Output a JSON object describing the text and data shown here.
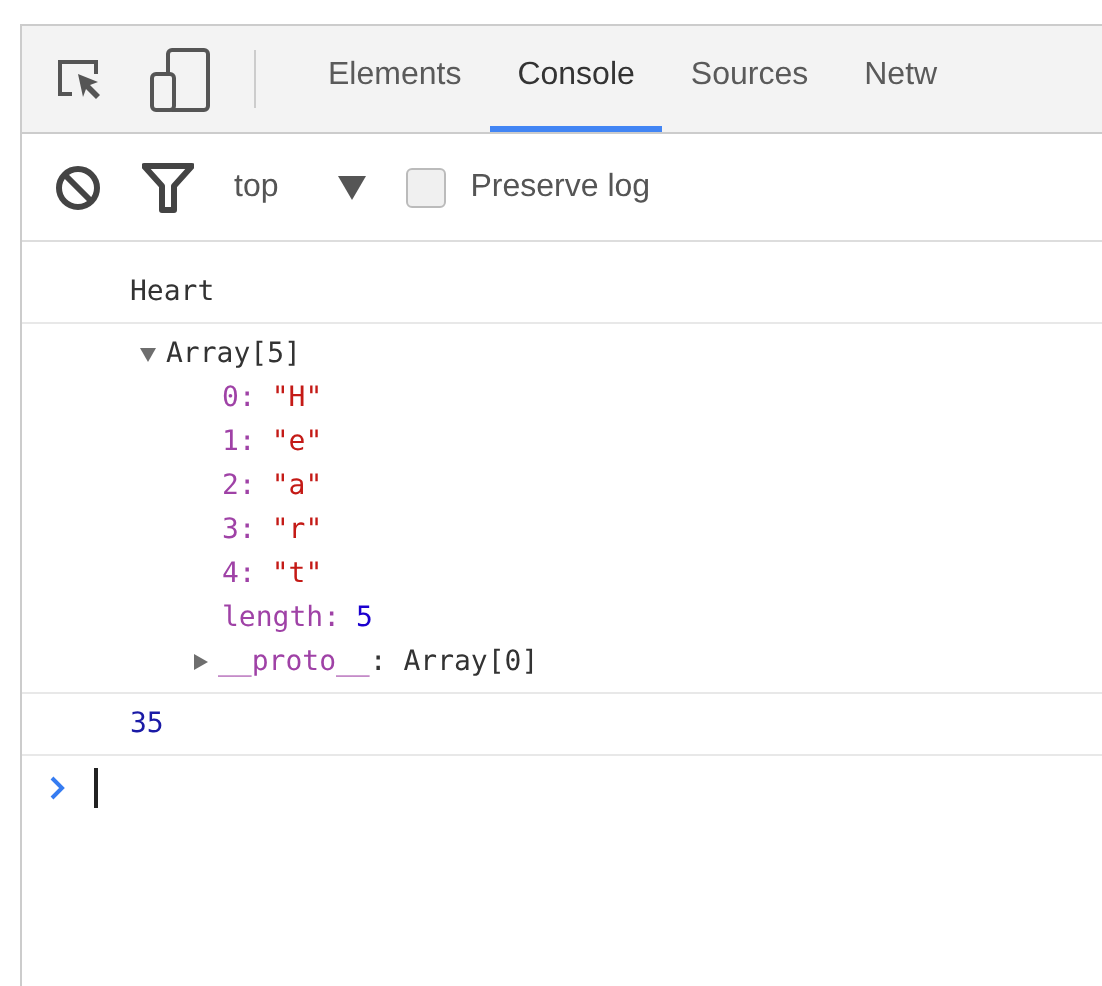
{
  "tabs": [
    {
      "label": "Elements",
      "selected": false
    },
    {
      "label": "Console",
      "selected": true
    },
    {
      "label": "Sources",
      "selected": false
    },
    {
      "label": "Netw",
      "selected": false
    }
  ],
  "filter_bar": {
    "context": "top",
    "preserve_log": {
      "label": "Preserve log",
      "checked": false
    }
  },
  "console": [
    {
      "kind": "log",
      "text": "Heart"
    },
    {
      "kind": "object",
      "label": "Array[5]",
      "expanded": true,
      "properties": [
        {
          "key": "0:",
          "value": "\"H\"",
          "kind": "string"
        },
        {
          "key": "1:",
          "value": "\"e\"",
          "kind": "string"
        },
        {
          "key": "2:",
          "value": "\"a\"",
          "kind": "string"
        },
        {
          "key": "3:",
          "value": "\"r\"",
          "kind": "string"
        },
        {
          "key": "4:",
          "value": "\"t\"",
          "kind": "string"
        },
        {
          "key": "length:",
          "value": "5",
          "kind": "number"
        }
      ],
      "proto": {
        "key": "__proto__",
        "value": ": Array[0]",
        "expanded": false
      }
    },
    {
      "kind": "result",
      "text": "35"
    }
  ]
}
